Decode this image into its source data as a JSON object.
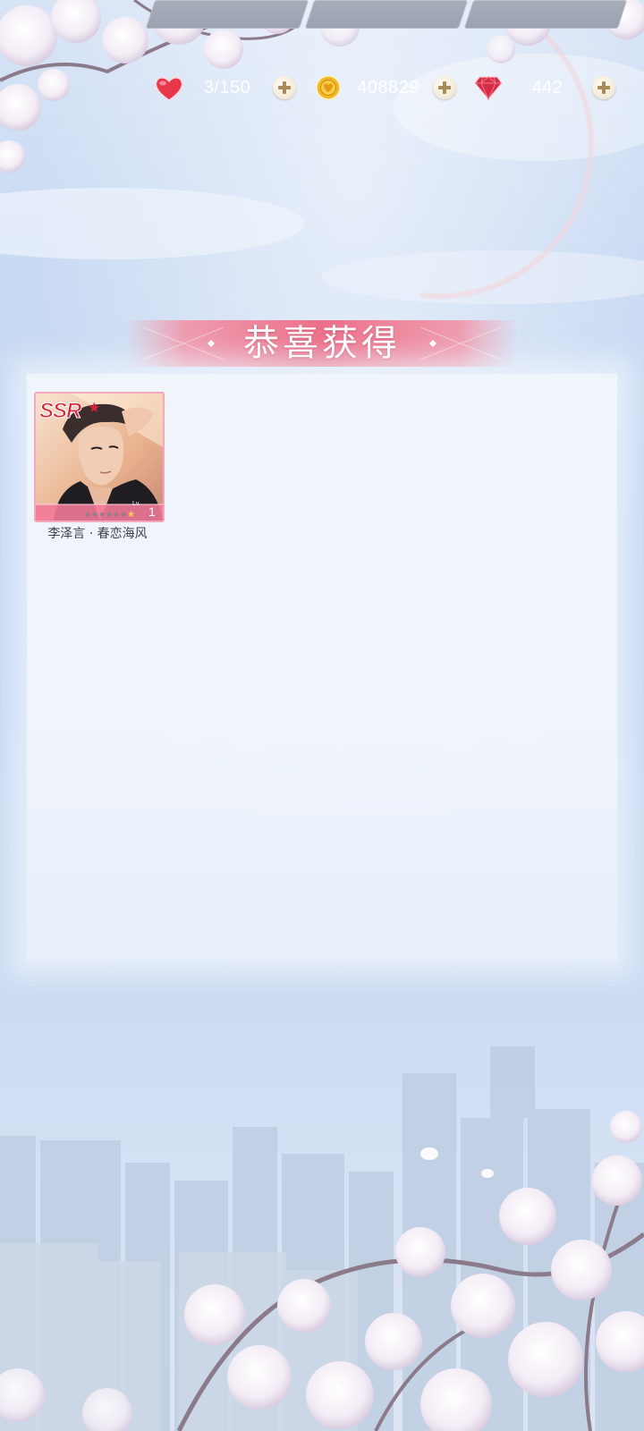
{
  "resources": {
    "stamina": {
      "value": "3/150",
      "icon": "heart-icon"
    },
    "gold": {
      "value": "408829",
      "icon": "gold-coin-icon"
    },
    "diamond": {
      "value": "442",
      "icon": "diamond-icon"
    }
  },
  "title": "恭喜获得",
  "rewards": [
    {
      "rarity": "SSR",
      "level_label": "Lv.",
      "level": "1",
      "name": "李泽言 · 春恋海风"
    }
  ],
  "colors": {
    "banner": "#ef7e94",
    "card_border": "#f4a8bd",
    "ssr": "#d9243c",
    "pill": "#a2a8b5"
  }
}
